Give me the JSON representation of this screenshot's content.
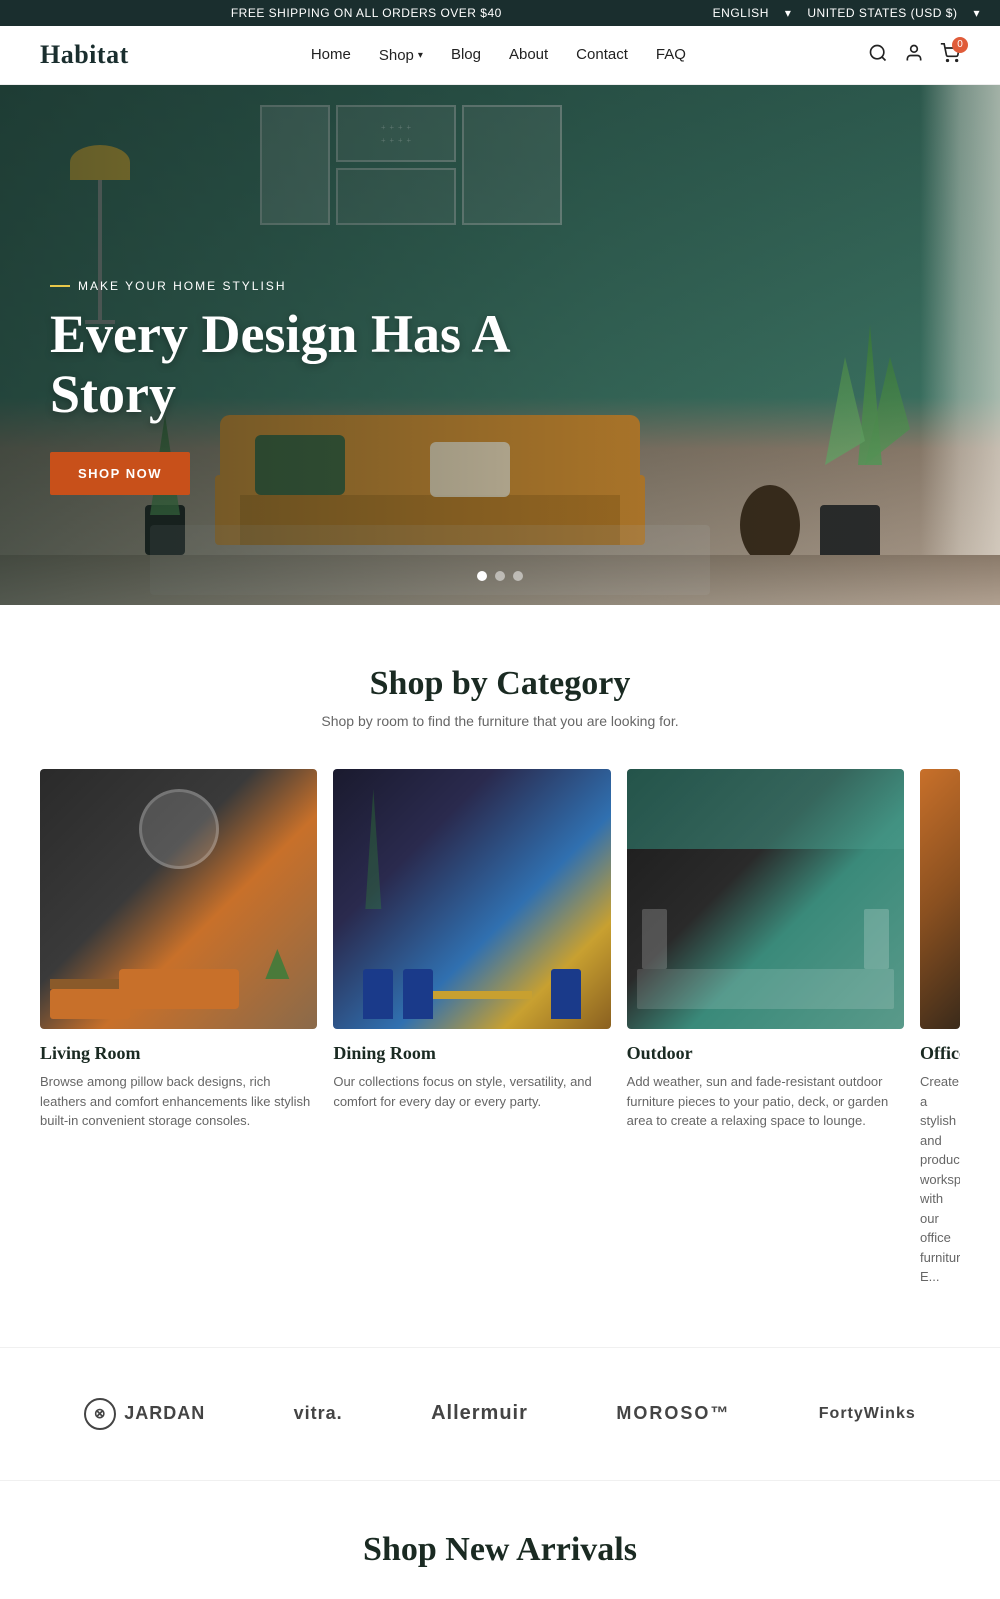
{
  "topbar": {
    "announcement": "FREE SHIPPING ON ALL ORDERS OVER $40",
    "language_label": "ENGLISH",
    "currency_label": "UNITED STATES (USD $)"
  },
  "header": {
    "logo": "Habitat",
    "nav": [
      {
        "label": "Home",
        "has_dropdown": false
      },
      {
        "label": "Shop",
        "has_dropdown": true
      },
      {
        "label": "Blog",
        "has_dropdown": false
      },
      {
        "label": "About",
        "has_dropdown": false
      },
      {
        "label": "Contact",
        "has_dropdown": false
      },
      {
        "label": "FAQ",
        "has_dropdown": false
      }
    ],
    "cart_count": "0"
  },
  "hero": {
    "eyebrow": "MAKE YOUR HOME STYLISH",
    "title_line1": "Every Design Has A",
    "title_line2": "Story",
    "cta_label": "SHOP NOW",
    "dots": [
      {
        "active": true
      },
      {
        "active": false
      },
      {
        "active": false
      }
    ]
  },
  "categories_section": {
    "title": "Shop by Category",
    "subtitle": "Shop by room to find the furniture that you are looking for.",
    "categories": [
      {
        "name": "Living Room",
        "description": "Browse among pillow back designs, rich leathers and comfort enhancements like stylish built-in convenient storage consoles."
      },
      {
        "name": "Dining Room",
        "description": "Our collections focus on style, versatility, and comfort for every day or every party."
      },
      {
        "name": "Outdoor",
        "description": "Add weather, sun and fade-resistant outdoor furniture pieces to your patio, deck, or garden area to create a relaxing space to lounge."
      },
      {
        "name": "Office",
        "description": "Create a stylish and productive workspace with our office furniture. E..."
      }
    ]
  },
  "brands": [
    {
      "name": "JARDAN",
      "style": "jardan"
    },
    {
      "name": "vitra.",
      "style": "vitra"
    },
    {
      "name": "Allermuir",
      "style": "allermuir"
    },
    {
      "name": "MOROSO™",
      "style": "moroso"
    },
    {
      "name": "FortyWinks",
      "style": "fortywinks"
    }
  ],
  "new_arrivals": {
    "title": "Shop New Arrivals"
  }
}
